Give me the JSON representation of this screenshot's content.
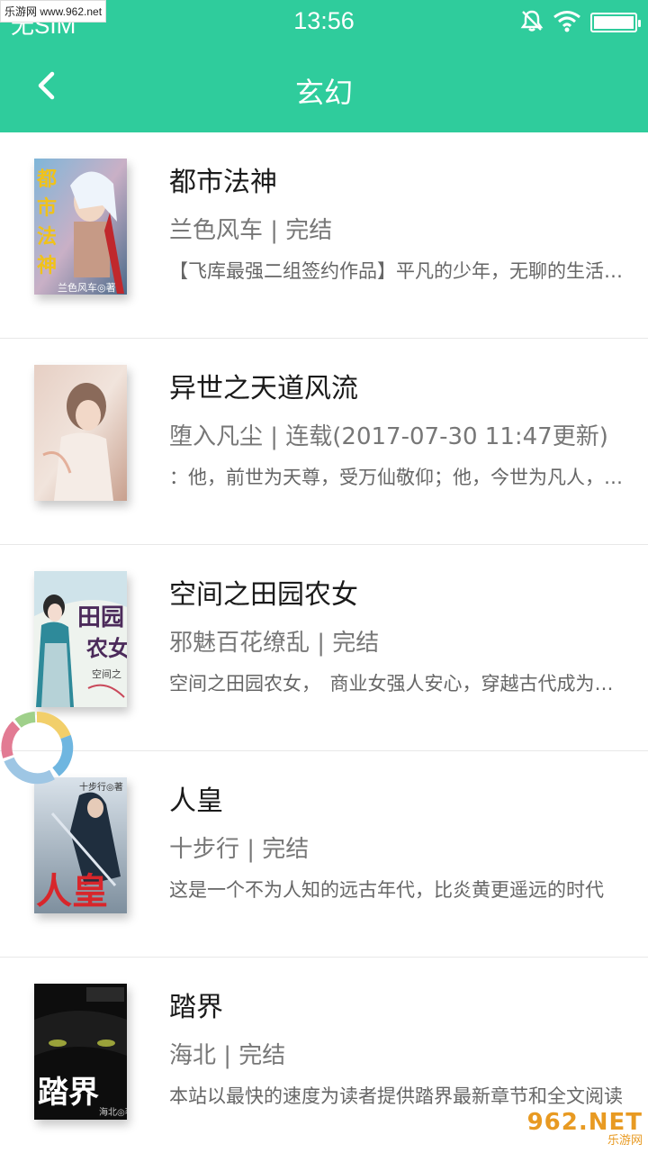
{
  "watermark_top": "乐游网 www.962.net",
  "status_bar": {
    "carrier": "无SIM",
    "time": "13:56",
    "battery_level": 1.0
  },
  "nav": {
    "title": "玄幻",
    "back_icon": "chevron-left-icon"
  },
  "books": [
    {
      "title": "都市法神",
      "meta": "兰色风车 | 完结",
      "desc": "【飞库最强二组签约作品】平凡的少年，无聊的生活，一次意外的奇遇",
      "cover_text": "都市法神",
      "cover_author": "兰色风车◎著"
    },
    {
      "title": "异世之天道风流",
      "meta": "堕入凡尘 | 连载(2017-07-30 11:47更新)",
      "desc": "：他，前世为天尊，受万仙敬仰；他，今世为凡人，受万人欺凌",
      "cover_text": "",
      "cover_author": ""
    },
    {
      "title": "空间之田园农女",
      "meta": "邪魅百花缭乱 | 完结",
      "desc": "空间之田园农女，　商业女强人安心，穿越古代成为农家小女",
      "cover_text": "田园农女",
      "cover_author": "空间之"
    },
    {
      "title": "人皇",
      "meta": "十步行 | 完结",
      "desc": "这是一个不为人知的远古年代，比炎黄更遥远的时代",
      "cover_text": "人皇",
      "cover_author": "十步行◎著"
    },
    {
      "title": "踏界",
      "meta": "海北 | 完结",
      "desc": "本站以最快的速度为读者提供踏界最新章节和全文阅读",
      "cover_text": "踏界",
      "cover_author": "海北◎著"
    }
  ],
  "watermark_bottom": {
    "logo": "962.NET",
    "sub": "乐游网"
  }
}
